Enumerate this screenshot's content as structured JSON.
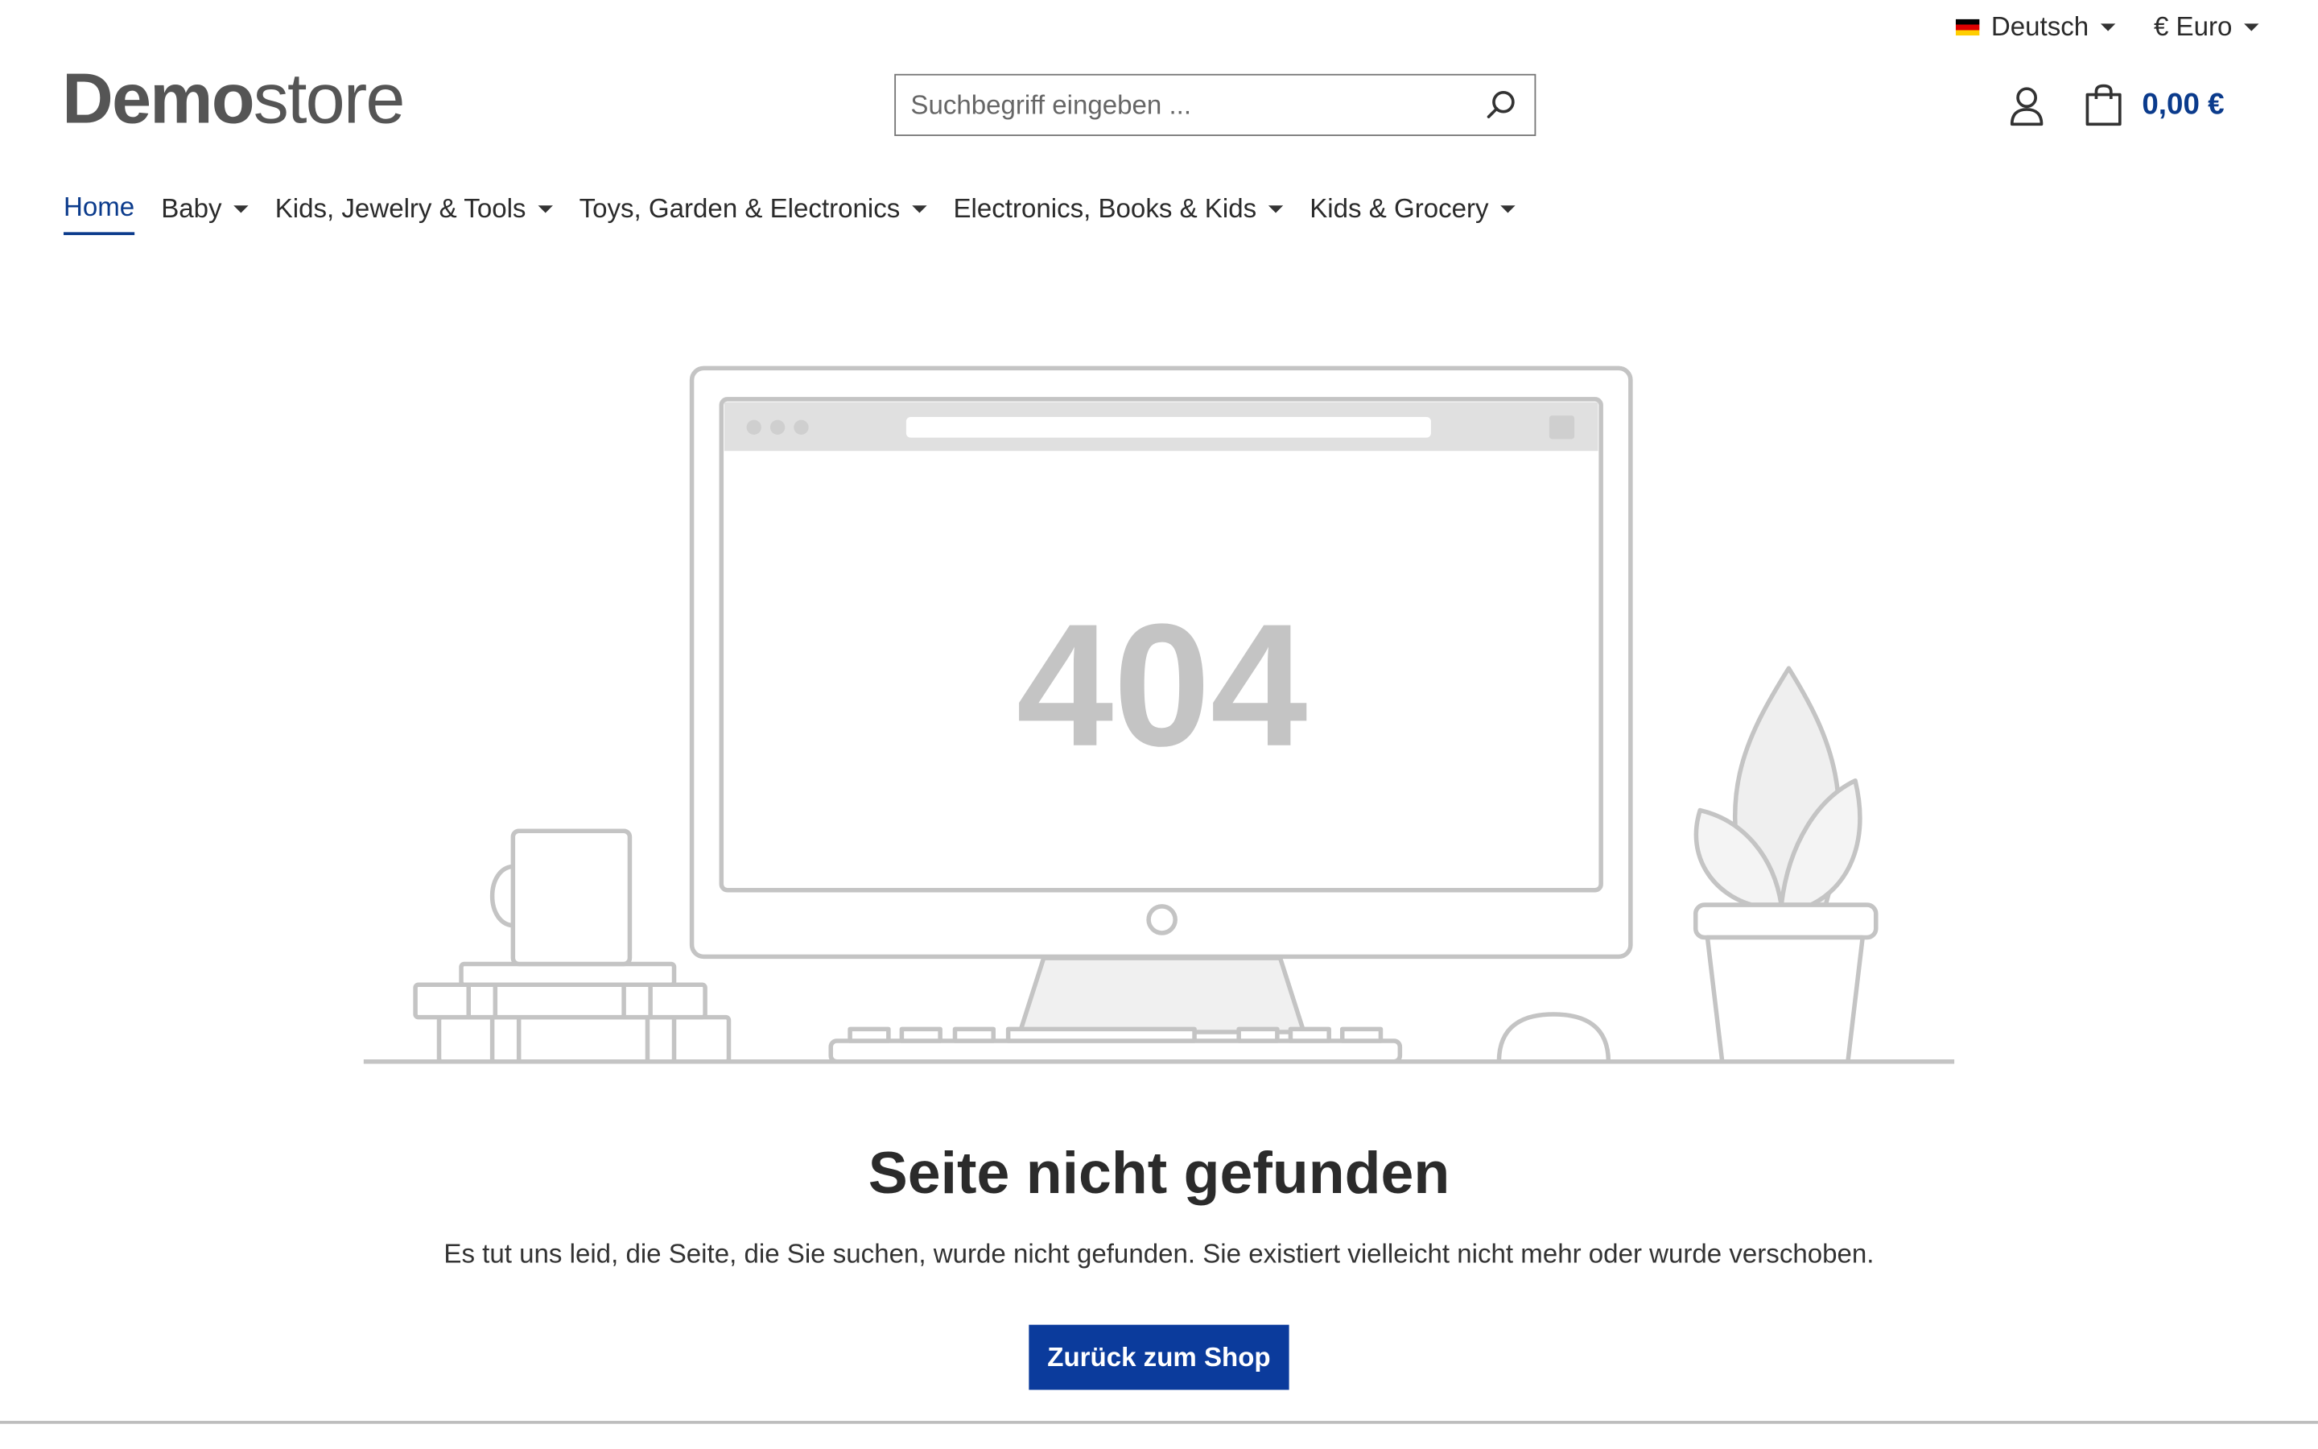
{
  "topbar": {
    "language": "Deutsch",
    "currency": "€ Euro"
  },
  "logo": {
    "bold": "Demo",
    "light": "store"
  },
  "search": {
    "placeholder": "Suchbegriff eingeben ..."
  },
  "cart": {
    "total": "0,00 €"
  },
  "nav": {
    "items": [
      {
        "label": "Home"
      },
      {
        "label": "Baby"
      },
      {
        "label": "Kids, Jewelry & Tools"
      },
      {
        "label": "Toys, Garden & Electronics"
      },
      {
        "label": "Electronics, Books & Kids"
      },
      {
        "label": "Kids & Grocery"
      }
    ]
  },
  "error": {
    "code": "404",
    "title": "Seite nicht gefunden",
    "description": "Es tut uns leid, die Seite, die Sie suchen, wurde nicht gefunden. Sie existiert vielleicht nicht mehr oder wurde verschoben.",
    "button": "Zurück zum Shop"
  },
  "colors": {
    "accent": "#0b3b9c",
    "illustration": "#c4c4c4"
  }
}
